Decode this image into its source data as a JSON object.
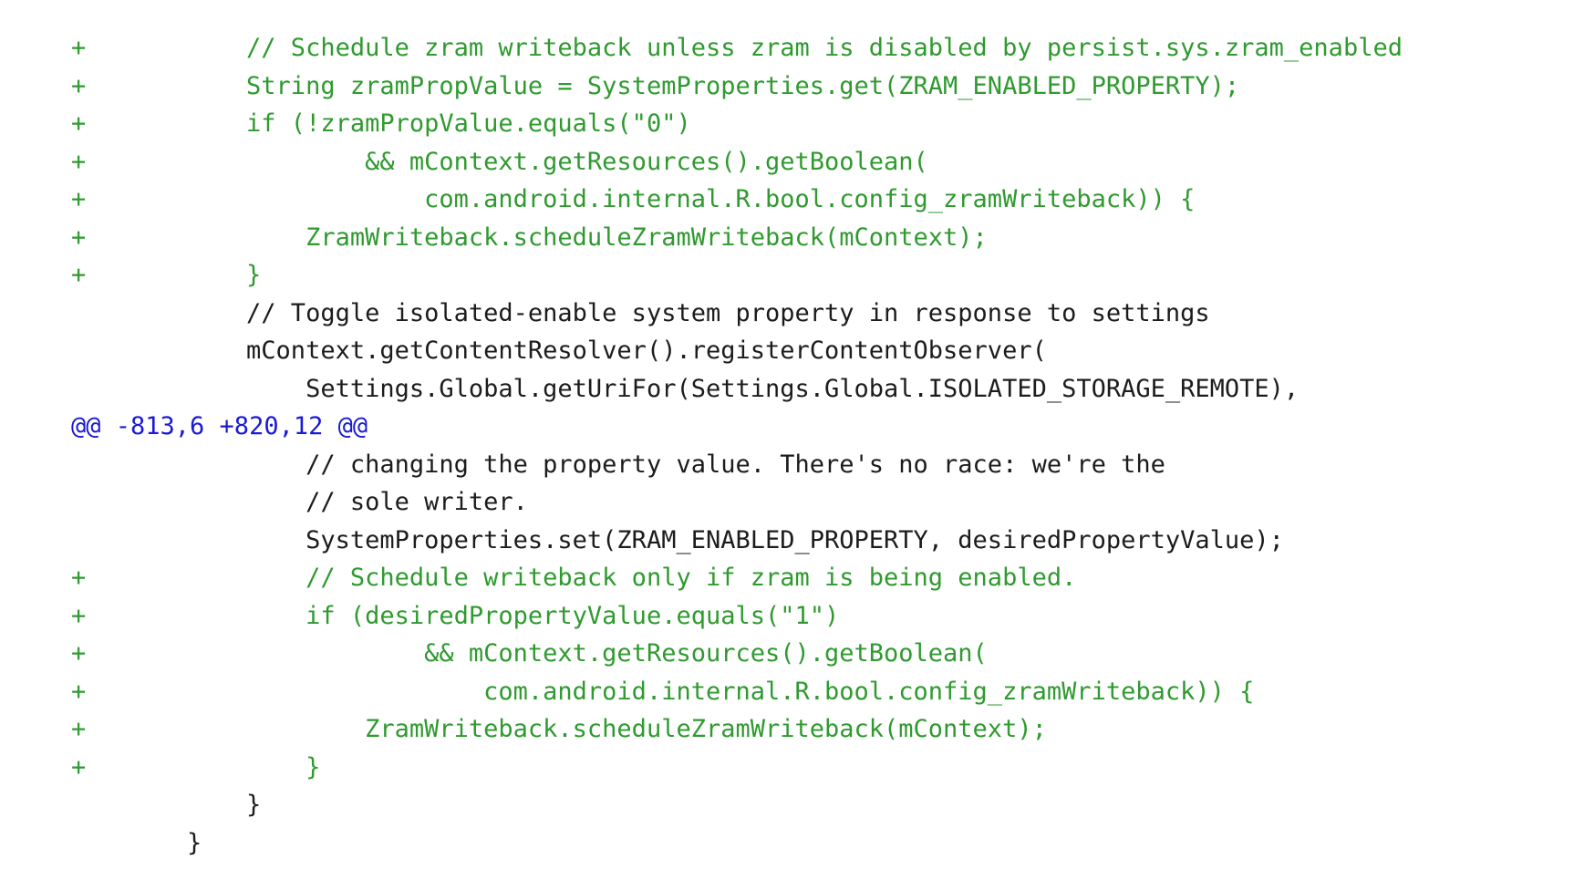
{
  "diff": {
    "colors": {
      "added": "#2f9a2f",
      "hunk": "#1a1ad6",
      "context": "#1c1c1c",
      "background": "#ffffff"
    },
    "lines": [
      {
        "type": "added",
        "marker": "+",
        "code": "        // Schedule zram writeback unless zram is disabled by persist.sys.zram_enabled"
      },
      {
        "type": "added",
        "marker": "+",
        "code": "        String zramPropValue = SystemProperties.get(ZRAM_ENABLED_PROPERTY);"
      },
      {
        "type": "added",
        "marker": "+",
        "code": "        if (!zramPropValue.equals(\"0\")"
      },
      {
        "type": "added",
        "marker": "+",
        "code": "                && mContext.getResources().getBoolean("
      },
      {
        "type": "added",
        "marker": "+",
        "code": "                    com.android.internal.R.bool.config_zramWriteback)) {"
      },
      {
        "type": "added",
        "marker": "+",
        "code": "            ZramWriteback.scheduleZramWriteback(mContext);"
      },
      {
        "type": "added",
        "marker": "+",
        "code": "        }"
      },
      {
        "type": "context",
        "marker": " ",
        "code": "        // Toggle isolated-enable system property in response to settings"
      },
      {
        "type": "context",
        "marker": " ",
        "code": "        mContext.getContentResolver().registerContentObserver("
      },
      {
        "type": "context",
        "marker": " ",
        "code": "            Settings.Global.getUriFor(Settings.Global.ISOLATED_STORAGE_REMOTE),"
      },
      {
        "type": "hunk",
        "marker": "",
        "code": "@@ -813,6 +820,12 @@"
      },
      {
        "type": "context",
        "marker": " ",
        "code": "            // changing the property value. There's no race: we're the"
      },
      {
        "type": "context",
        "marker": " ",
        "code": "            // sole writer."
      },
      {
        "type": "context",
        "marker": " ",
        "code": "            SystemProperties.set(ZRAM_ENABLED_PROPERTY, desiredPropertyValue);"
      },
      {
        "type": "added",
        "marker": "+",
        "code": "            // Schedule writeback only if zram is being enabled."
      },
      {
        "type": "added",
        "marker": "+",
        "code": "            if (desiredPropertyValue.equals(\"1\")"
      },
      {
        "type": "added",
        "marker": "+",
        "code": "                    && mContext.getResources().getBoolean("
      },
      {
        "type": "added",
        "marker": "+",
        "code": "                        com.android.internal.R.bool.config_zramWriteback)) {"
      },
      {
        "type": "added",
        "marker": "+",
        "code": "                ZramWriteback.scheduleZramWriteback(mContext);"
      },
      {
        "type": "added",
        "marker": "+",
        "code": "            }"
      },
      {
        "type": "context",
        "marker": " ",
        "code": "        }"
      },
      {
        "type": "context",
        "marker": " ",
        "code": "    }"
      }
    ]
  }
}
